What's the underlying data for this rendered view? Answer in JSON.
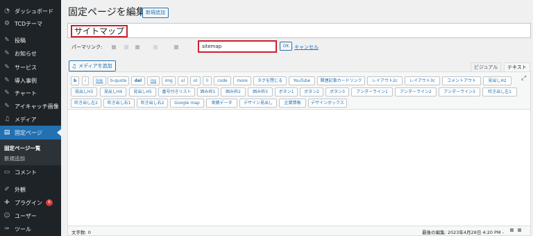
{
  "sidebar": {
    "items": [
      {
        "label": "ダッシュボード",
        "icon": "dashboard-icon"
      },
      {
        "label": "TCDテーマ",
        "icon": "gear-icon"
      },
      {
        "label": "投稿",
        "icon": "pin-icon"
      },
      {
        "label": "お知らせ",
        "icon": "pin-icon"
      },
      {
        "label": "サービス",
        "icon": "pin-icon"
      },
      {
        "label": "導入事例",
        "icon": "pin-icon"
      },
      {
        "label": "チャート",
        "icon": "pin-icon"
      },
      {
        "label": "アイキャッチ画像",
        "icon": "pin-icon"
      },
      {
        "label": "メディア",
        "icon": "media-icon"
      },
      {
        "label": "固定ページ",
        "icon": "page-icon"
      },
      {
        "label": "コメント",
        "icon": "comment-icon"
      },
      {
        "label": "外観",
        "icon": "brush-icon"
      },
      {
        "label": "プラグイン",
        "icon": "plugin-icon",
        "badge": "6"
      },
      {
        "label": "ユーザー",
        "icon": "user-icon"
      },
      {
        "label": "ツール",
        "icon": "wrench-icon"
      }
    ],
    "submenu": {
      "current": "固定ページ一覧",
      "other": "新規追加"
    }
  },
  "header": {
    "title": "固定ページを編集",
    "add_new": "新規追加"
  },
  "post_title": "サイトマップ",
  "permalink": {
    "label": "パーマリンク:",
    "slug": "sitemap",
    "ok": "OK",
    "cancel": "キャンセル"
  },
  "editor": {
    "add_media": "メディアを追加",
    "tab_visual": "ビジュアル",
    "tab_text": "テキスト",
    "quicktags": [
      "b",
      "i",
      "link",
      "b-quote",
      "del",
      "ins",
      "img",
      "ul",
      "ol",
      "li",
      "code",
      "more",
      "タグを閉じる",
      "YouTube",
      "関連記事カードリンク",
      "レイアウト2c",
      "レイアウト3c",
      "コメントアウト",
      "見出しH2",
      "見出しH3",
      "見出しH4",
      "見出しH5",
      "番号付きリスト",
      "囲み枠1",
      "囲み枠2",
      "囲み枠3",
      "ボタン1",
      "ボタン2",
      "ボタン3",
      "アンダーライン1",
      "アンダーライン2",
      "アンダーライン3",
      "吹き出し左1",
      "吹き出し左2",
      "吹き出し右1",
      "吹き出し右2",
      "Google map",
      "実績データ",
      "デザイン見出し",
      "企業情報",
      "デザインボックス"
    ],
    "word_count": "文字数: 0",
    "last_edit": "最後の編集: 2023年4月28日 4:20 PM -"
  },
  "colors": {
    "sidebar_bg": "#1d2327",
    "accent": "#2271b1",
    "highlight_border": "#c8202f",
    "badge": "#d63638"
  }
}
